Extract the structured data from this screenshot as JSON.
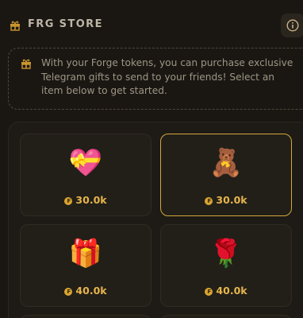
{
  "header": {
    "title": "FRG STORE",
    "gift_icon": "gift-icon",
    "info_icon": "info-icon"
  },
  "notice": {
    "icon": "gift-icon",
    "text": "With your Forge tokens, you can purchase exclusive Telegram gifts to send to your friends! Select an item below to get started."
  },
  "store": {
    "currency_symbol": "₣",
    "items": [
      {
        "emoji": "💝",
        "name": "heart-gift",
        "price": "30.0k",
        "selected": false
      },
      {
        "emoji": "🧸",
        "name": "teddy-bear",
        "price": "30.0k",
        "selected": true
      },
      {
        "emoji": "🎁",
        "name": "gift-box",
        "price": "40.0k",
        "selected": false
      },
      {
        "emoji": "🌹",
        "name": "rose",
        "price": "40.0k",
        "selected": false
      }
    ]
  },
  "colors": {
    "background": "#1a1713",
    "accent": "#e6b54a",
    "selected_border": "#d4a73a"
  }
}
